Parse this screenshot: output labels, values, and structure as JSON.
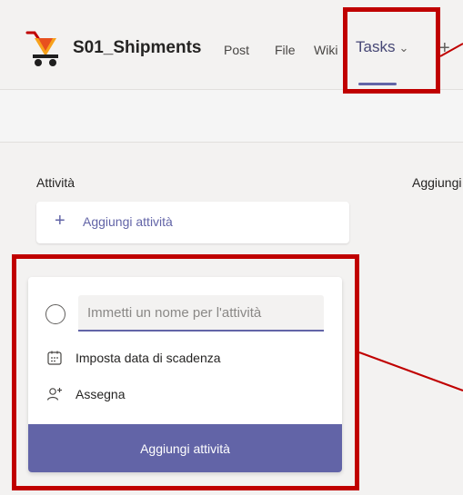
{
  "header": {
    "channel_name": "S01_Shipments",
    "tabs": [
      {
        "label": "Post"
      },
      {
        "label": "File"
      },
      {
        "label": "Wiki"
      },
      {
        "label": "Tasks",
        "active": true
      }
    ],
    "add_tab_label": "+"
  },
  "board": {
    "bucket_title": "Attività",
    "second_bucket_title": "Aggiungi",
    "add_task_label": "Aggiungi attività"
  },
  "new_task_card": {
    "name_placeholder": "Immetti un nome per l'attività",
    "due_date_label": "Imposta data di scadenza",
    "assign_label": "Assegna",
    "submit_label": "Aggiungi attività"
  },
  "colors": {
    "accent": "#6264a7",
    "annotation": "#c00000"
  },
  "icons": {
    "app": "shopping-cart-icon",
    "tab_dropdown": "chevron-down-icon",
    "add": "plus-icon",
    "complete": "radio-circle-icon",
    "due_date": "calendar-icon",
    "assign": "person-add-icon"
  }
}
